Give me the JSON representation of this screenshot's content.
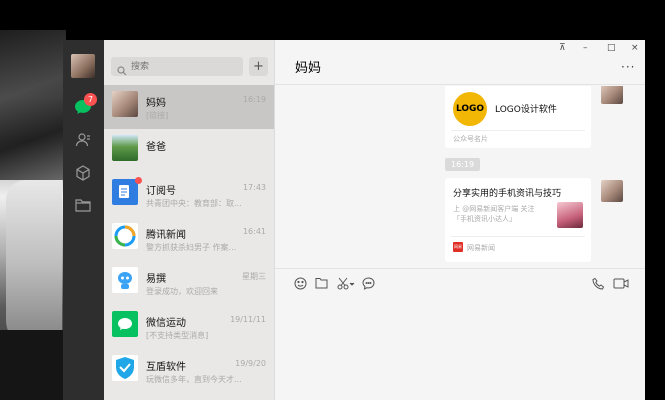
{
  "chat": {
    "title": "妈妈",
    "more_label": "···"
  },
  "window_controls": {
    "pin": "⊼",
    "minimize": "–",
    "maximize": "□",
    "close": "×"
  },
  "sidebar": {
    "badge_count": "7"
  },
  "search": {
    "placeholder": "搜索",
    "add_label": "+"
  },
  "conversations": [
    {
      "name": "妈妈",
      "time": "16:19",
      "preview": "[链接]",
      "active": true
    },
    {
      "name": "爸爸",
      "time": "",
      "preview": "",
      "active": false
    },
    {
      "name": "订阅号",
      "time": "17:43",
      "preview": "共青团中央：教育部：取...",
      "active": false
    },
    {
      "name": "腾讯新闻",
      "time": "16:41",
      "preview": "警方抓获杀妇男子 作案...",
      "active": false
    },
    {
      "name": "易撰",
      "time": "星期三",
      "preview": "登录成功，欢迎回来",
      "active": false
    },
    {
      "name": "微信运动",
      "time": "19/11/11",
      "preview": "[不支持类型消息]",
      "active": false
    },
    {
      "name": "互盾软件",
      "time": "19/9/20",
      "preview": "玩微信多年，直到今天才...",
      "active": false
    }
  ],
  "messages": {
    "card1": {
      "logo_text": "LOGO",
      "title": "LOGO设计软件",
      "footer": "公众号名片"
    },
    "time_divider": "16:19",
    "card2": {
      "title": "分享实用的手机资讯与技巧",
      "desc": "上 @网易新闻客户端 关注 「手机资讯小达人」",
      "source_icon": "网易",
      "source": "网易新闻"
    }
  },
  "colors": {
    "nav_bg": "#2e2e2e",
    "list_bg": "#e9e8e7",
    "active_item": "#c9c7c6",
    "badge": "#fa5151",
    "wechat_green": "#07c160"
  }
}
